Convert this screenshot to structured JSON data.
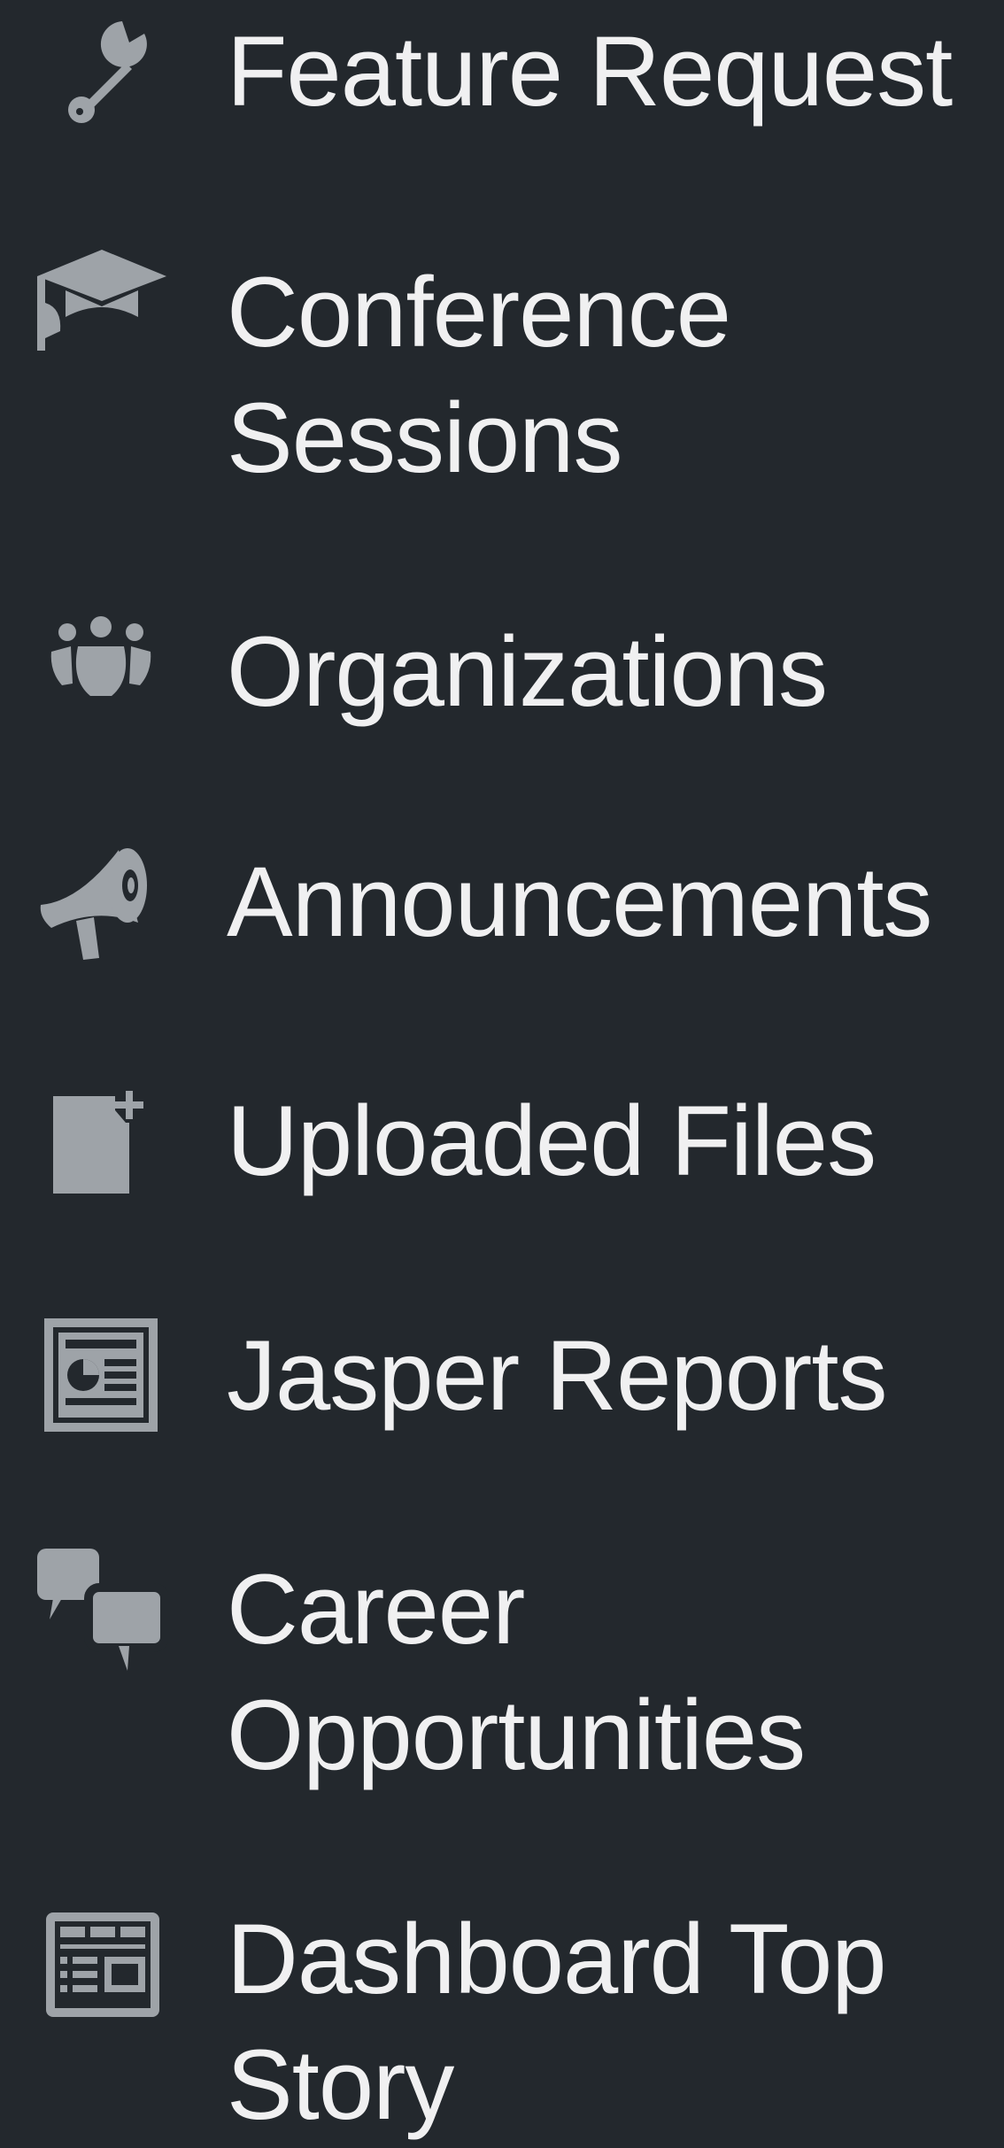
{
  "sidebar": {
    "icon_color": "#9ea3a8",
    "text_color": "#f0f0f1",
    "background": "#23282d",
    "items": [
      {
        "label": "Feature Request",
        "icon": "wrench-icon"
      },
      {
        "label": "Conference Sessions",
        "icon": "graduation-cap-icon"
      },
      {
        "label": "Organizations",
        "icon": "groups-icon"
      },
      {
        "label": "Announcements",
        "icon": "megaphone-icon"
      },
      {
        "label": "Uploaded Files",
        "icon": "media-document-icon"
      },
      {
        "label": "Jasper Reports",
        "icon": "id-card-chart-icon"
      },
      {
        "label": "Career Opportunities",
        "icon": "chat-bubbles-icon"
      },
      {
        "label": "Dashboard Top Story",
        "icon": "layout-grid-icon"
      }
    ]
  }
}
